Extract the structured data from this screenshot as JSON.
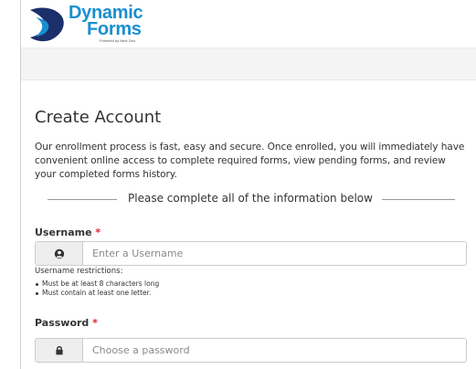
{
  "brand": {
    "name_line1": "Dynamic",
    "name_line2": "Forms",
    "tagline": "Powered by Next Gen",
    "color": "#1a8fd0"
  },
  "page": {
    "title": "Create Account",
    "intro": "Our enrollment process is fast, easy and secure. Once enrolled, you will immediately have convenient online access to complete required forms, view pending forms, and review your completed forms history.",
    "divider_text": "Please complete all of the information below"
  },
  "form": {
    "required_marker": "*",
    "username": {
      "label": "Username",
      "icon": "user-icon",
      "placeholder": "Enter a Username",
      "value": "",
      "restrictions_title": "Username restrictions:",
      "restrictions": [
        "Must be at least 8 characters long",
        "Must contain at least one letter."
      ]
    },
    "password": {
      "label": "Password",
      "icon": "lock-icon",
      "placeholder": "Choose a password",
      "value": ""
    }
  },
  "colors": {
    "required": "#d9232d",
    "addon_bg": "#eeeeee",
    "border": "#cccccc"
  }
}
